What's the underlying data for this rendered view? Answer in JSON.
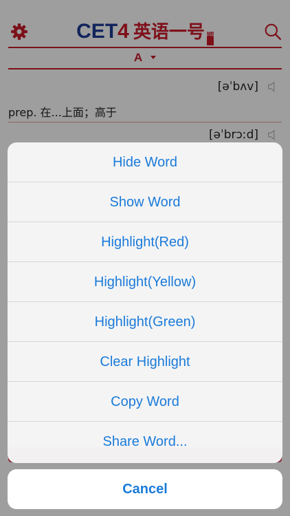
{
  "header": {
    "logo_cet": "CET",
    "logo_four": "4",
    "logo_cn": "英语一号",
    "logo_badge": "四级"
  },
  "section": {
    "letter": "A"
  },
  "words": [
    {
      "phonetic": "[əˈbʌv]",
      "definition": "prep. 在...上面；高于"
    },
    {
      "phonetic": "[əˈbrɔːd]"
    }
  ],
  "action_sheet": {
    "items": [
      "Hide Word",
      "Show Word",
      "Highlight(Red)",
      "Highlight(Yellow)",
      "Highlight(Green)",
      "Clear Highlight",
      "Copy Word",
      "Share Word..."
    ],
    "cancel_label": "Cancel"
  },
  "colors": {
    "accent_red": "#c81b2a",
    "logo_blue": "#1c3a94",
    "action_blue": "#1a7bd9"
  },
  "icons": {
    "settings": "gear-icon",
    "search": "search-icon",
    "speaker": "speaker-icon",
    "dropdown": "caret-down-icon"
  }
}
